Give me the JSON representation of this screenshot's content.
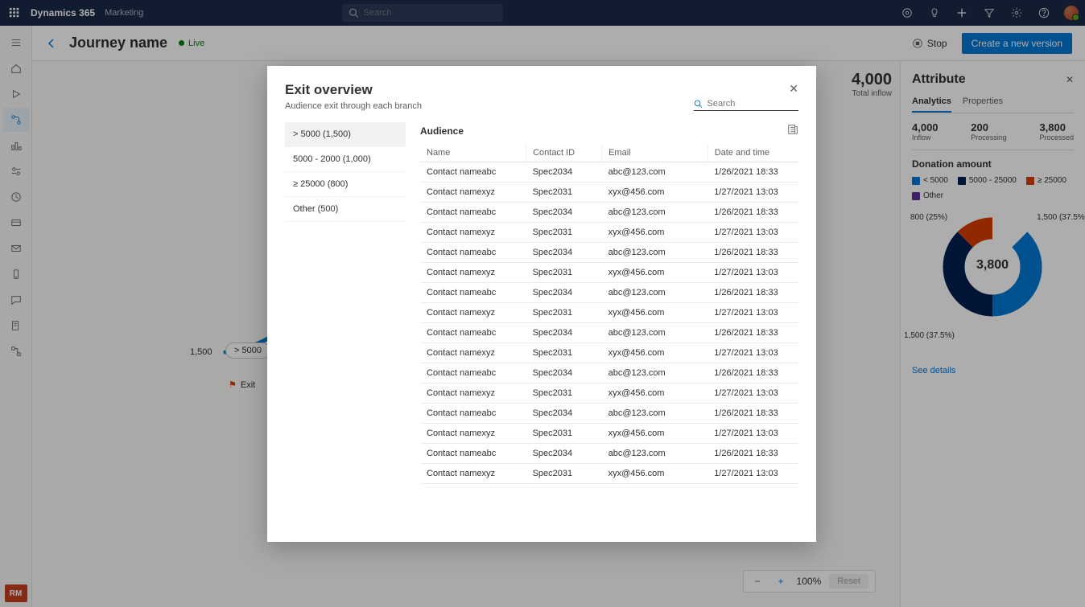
{
  "app": {
    "brand": "Dynamics 365",
    "section": "Marketing"
  },
  "topbar_search": {
    "placeholder": "Search"
  },
  "page": {
    "title": "Journey name",
    "status": "Live"
  },
  "commands": {
    "stop": "Stop",
    "create_version": "Create a new version"
  },
  "inflow": {
    "value": "4,000",
    "label": "Total inflow"
  },
  "journey": {
    "count": "1,500",
    "node_label": "> 5000",
    "exit_label": "Exit"
  },
  "rightpanel": {
    "title": "Attribute",
    "tabs": {
      "analytics": "Analytics",
      "properties": "Properties"
    },
    "stats": [
      {
        "v": "4,000",
        "l": "Inflow"
      },
      {
        "v": "200",
        "l": "Processing"
      },
      {
        "v": "3,800",
        "l": "Processed"
      }
    ],
    "section": "Donation amount",
    "legend": [
      {
        "label": "< 5000",
        "color": "#0078d4"
      },
      {
        "label": "5000 - 25000",
        "color": "#002050"
      },
      {
        "label": "≥ 25000",
        "color": "#d83b01"
      },
      {
        "label": "Other",
        "color": "#5c2e91"
      }
    ],
    "donut_center": "3,800",
    "donut_labels": {
      "tl": "800 (25%)",
      "tr": "1,500 (37.5%)",
      "bl": "1,500 (37.5%)"
    },
    "see_details": "See details"
  },
  "chart_data": {
    "type": "pie",
    "title": "Donation amount",
    "series": [
      {
        "name": "< 5000",
        "value": 1500,
        "pct": 37.5,
        "color": "#0078d4"
      },
      {
        "name": "5000 - 25000",
        "value": 1500,
        "pct": 37.5,
        "color": "#002050"
      },
      {
        "name": "≥ 25000",
        "value": 800,
        "pct": 25.0,
        "color": "#d83b01"
      },
      {
        "name": "Other",
        "value": 0,
        "pct": 0,
        "color": "#5c2e91"
      }
    ],
    "center_value": 3800
  },
  "zoom": {
    "level": "100%",
    "reset": "Reset"
  },
  "modal": {
    "title": "Exit overview",
    "subtitle": "Audience exit through each branch",
    "search_placeholder": "Search",
    "branches": [
      {
        "label": "> 5000 (1,500)",
        "selected": true
      },
      {
        "label": "5000 - 2000 (1,000)",
        "selected": false
      },
      {
        "label": "≥ 25000 (800)",
        "selected": false
      },
      {
        "label": "Other (500)",
        "selected": false
      }
    ],
    "audience_label": "Audience",
    "columns": [
      "Name",
      "Contact ID",
      "Email",
      "Date and time"
    ],
    "rows": [
      {
        "name": "Contact nameabc",
        "id": "Spec2034",
        "email": "abc@123.com",
        "dt": "1/26/2021 18:33"
      },
      {
        "name": "Contact namexyz",
        "id": "Spec2031",
        "email": "xyx@456.com",
        "dt": "1/27/2021 13:03"
      },
      {
        "name": "Contact nameabc",
        "id": "Spec2034",
        "email": "abc@123.com",
        "dt": "1/26/2021 18:33"
      },
      {
        "name": "Contact namexyz",
        "id": "Spec2031",
        "email": "xyx@456.com",
        "dt": "1/27/2021 13:03"
      },
      {
        "name": "Contact nameabc",
        "id": "Spec2034",
        "email": "abc@123.com",
        "dt": "1/26/2021 18:33"
      },
      {
        "name": "Contact namexyz",
        "id": "Spec2031",
        "email": "xyx@456.com",
        "dt": "1/27/2021 13:03"
      },
      {
        "name": "Contact nameabc",
        "id": "Spec2034",
        "email": "abc@123.com",
        "dt": "1/26/2021 18:33"
      },
      {
        "name": "Contact namexyz",
        "id": "Spec2031",
        "email": "xyx@456.com",
        "dt": "1/27/2021 13:03"
      },
      {
        "name": "Contact nameabc",
        "id": "Spec2034",
        "email": "abc@123.com",
        "dt": "1/26/2021 18:33"
      },
      {
        "name": "Contact namexyz",
        "id": "Spec2031",
        "email": "xyx@456.com",
        "dt": "1/27/2021 13:03"
      },
      {
        "name": "Contact nameabc",
        "id": "Spec2034",
        "email": "abc@123.com",
        "dt": "1/26/2021 18:33"
      },
      {
        "name": "Contact namexyz",
        "id": "Spec2031",
        "email": "xyx@456.com",
        "dt": "1/27/2021 13:03"
      },
      {
        "name": "Contact nameabc",
        "id": "Spec2034",
        "email": "abc@123.com",
        "dt": "1/26/2021 18:33"
      },
      {
        "name": "Contact namexyz",
        "id": "Spec2031",
        "email": "xyx@456.com",
        "dt": "1/27/2021 13:03"
      },
      {
        "name": "Contact nameabc",
        "id": "Spec2034",
        "email": "abc@123.com",
        "dt": "1/26/2021 18:33"
      },
      {
        "name": "Contact namexyz",
        "id": "Spec2031",
        "email": "xyx@456.com",
        "dt": "1/27/2021 13:03"
      }
    ]
  },
  "rm_badge": "RM"
}
